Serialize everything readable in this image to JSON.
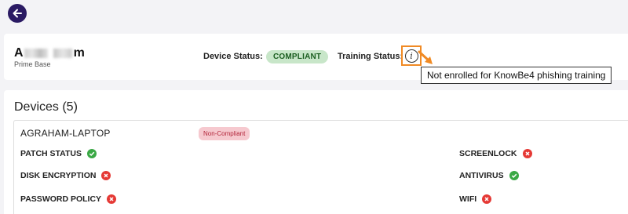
{
  "user": {
    "name_first_initial": "A",
    "name_last_letter": "m",
    "subtitle": "Prime Base"
  },
  "status": {
    "device_label": "Device Status:",
    "device_value": "COMPLIANT",
    "training_label": "Training Status:",
    "tooltip": "Not enrolled for KnowBe4 phishing training"
  },
  "devices": {
    "title": "Devices (5)",
    "device_name": "AGRAHAM-LAPTOP",
    "device_badge": "Non-Compliant",
    "checks": [
      {
        "label": "PATCH STATUS",
        "state": "ok"
      },
      {
        "label": "DISK ENCRYPTION",
        "state": "bad"
      },
      {
        "label": "PASSWORD POLICY",
        "state": "bad"
      },
      {
        "label": "SCREENLOCK",
        "state": "bad"
      },
      {
        "label": "ANTIVIRUS",
        "state": "ok"
      },
      {
        "label": "WIFI",
        "state": "bad"
      }
    ]
  },
  "colors": {
    "brand": "#2a1a63",
    "highlight": "#f08a24",
    "ok": "#3aa845",
    "bad": "#e53935"
  },
  "icons": {
    "back": "arrow-left-icon",
    "info": "info-icon",
    "ok": "check-circle-icon",
    "bad": "x-circle-icon"
  }
}
